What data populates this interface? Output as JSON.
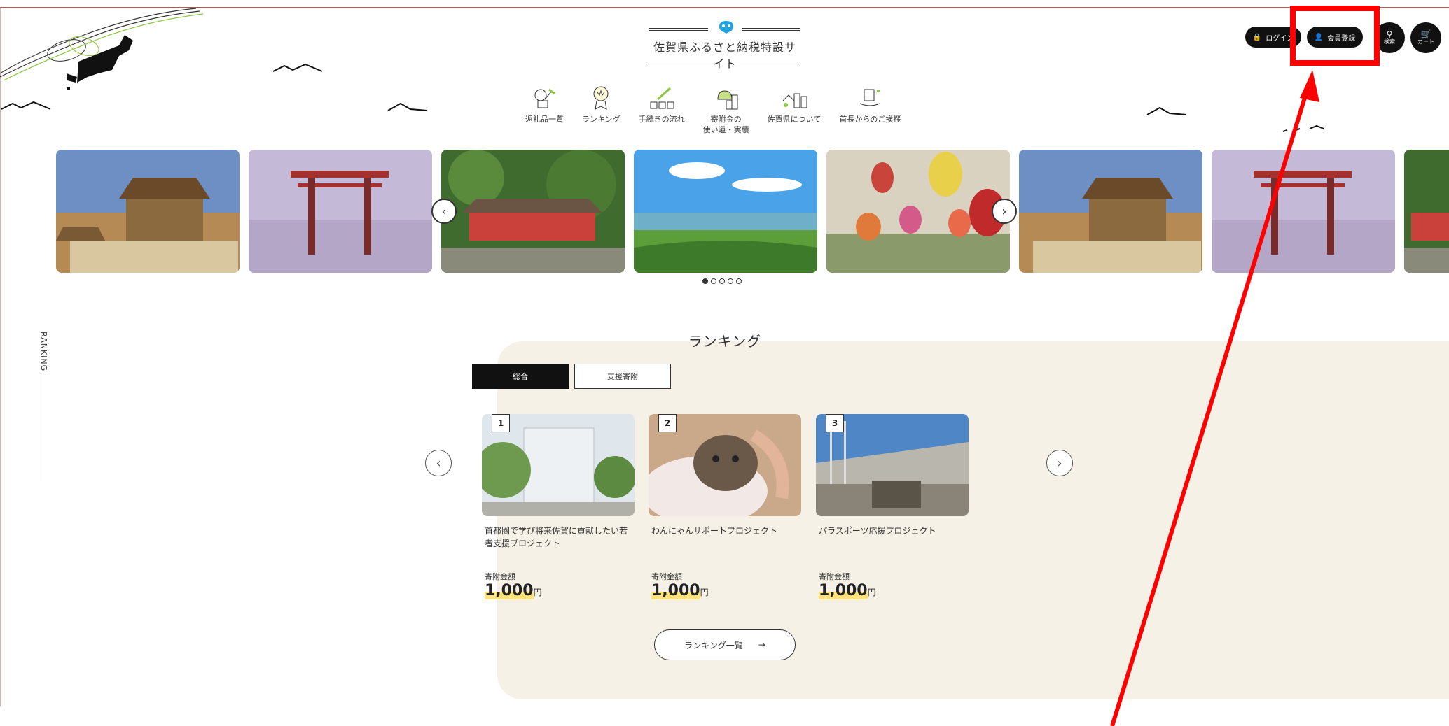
{
  "header": {
    "site_title": "佐賀県ふるさと納税特設サイト",
    "login_label": "ログイン",
    "register_label": "会員登録",
    "search_label": "検索",
    "cart_label": "カート"
  },
  "nav": {
    "items": [
      {
        "label": "返礼品一覧",
        "icon": "gift-icon"
      },
      {
        "label": "ランキング",
        "icon": "ranking-icon"
      },
      {
        "label": "手続きの流れ",
        "icon": "procedure-icon"
      },
      {
        "label": "寄附金の\n使い道・実績",
        "icon": "money-bag-icon"
      },
      {
        "label": "佐賀県について",
        "icon": "town-icon"
      },
      {
        "label": "首長からのご挨拶",
        "icon": "building-hands-icon"
      }
    ]
  },
  "carousel": {
    "slides": [
      "castle",
      "torii",
      "shrine",
      "landscape",
      "balloons",
      "castle",
      "torii",
      "shrine"
    ],
    "dot_count": 5,
    "active_dot": 0
  },
  "ranking": {
    "side_label": "RANKING",
    "title": "ランキング",
    "tabs": [
      "総合",
      "支援寄附"
    ],
    "active_tab": 0,
    "cards": [
      {
        "rank": "1",
        "name": "首都圏で学び将来佐賀に貢献したい若者支援プロジェクト",
        "amount_label": "寄附金額",
        "amount": "1,000",
        "unit": "円"
      },
      {
        "rank": "2",
        "name": "わんにゃんサポートプロジェクト",
        "amount_label": "寄附金額",
        "amount": "1,000",
        "unit": "円"
      },
      {
        "rank": "3",
        "name": "パラスポーツ応援プロジェクト",
        "amount_label": "寄附金額",
        "amount": "1,000",
        "unit": "円"
      }
    ],
    "all_button_label": "ランキング一覧",
    "all_button_arrow": "→"
  },
  "colors": {
    "highlight": "#ff0000",
    "ranking_bg": "#f5f1e6",
    "amount_marker": "#ffe27a",
    "brand_blue": "#1fa3e0"
  }
}
